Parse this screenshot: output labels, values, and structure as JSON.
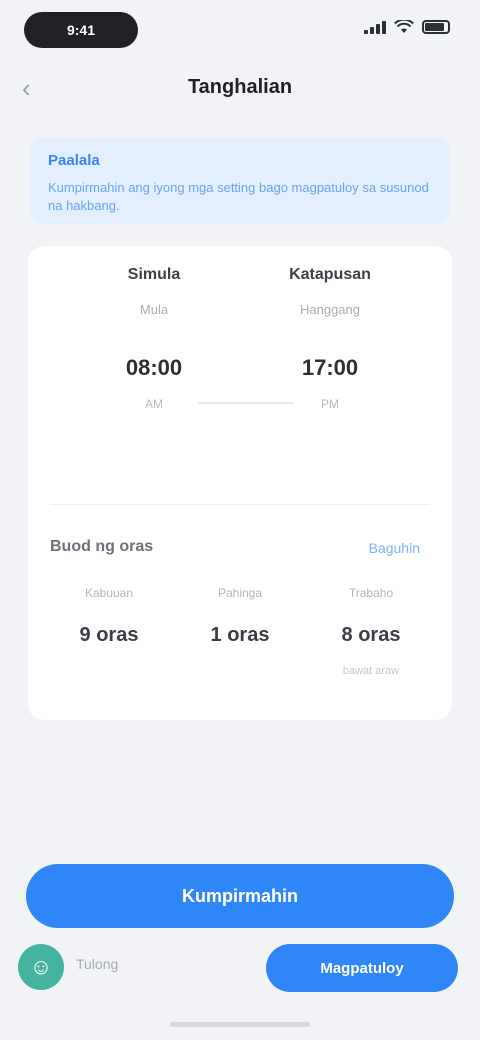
{
  "status_bar": {
    "time": "9:41"
  },
  "nav": {
    "title": "Tanghalian"
  },
  "notice": {
    "title": "Paalala",
    "text": "Kumpirmahin ang iyong mga setting bago magpatuloy sa susunod na hakbang."
  },
  "fields": {
    "left": {
      "label": "Simula",
      "sub": "Mula",
      "value": "08:00",
      "unit": "AM"
    },
    "right": {
      "label": "Katapusan",
      "sub": "Hanggang",
      "value": "17:00",
      "unit": "PM"
    }
  },
  "section": {
    "title": "Buod ng oras",
    "link": "Baguhin"
  },
  "stats": [
    {
      "label": "Kabuuan",
      "value": "9 oras",
      "note": ""
    },
    {
      "label": "Pahinga",
      "value": "1 oras",
      "note": ""
    },
    {
      "label": "Trabaho",
      "value": "8 oras",
      "note": "bawat araw"
    }
  ],
  "primary_button": "Kumpirmahin",
  "bottom": {
    "helper": "Tulong",
    "secondary_button": "Magpatuloy"
  },
  "colors": {
    "accent": "#2f86f6",
    "notice_bg": "#e3efff",
    "background": "#f2f3f6"
  }
}
